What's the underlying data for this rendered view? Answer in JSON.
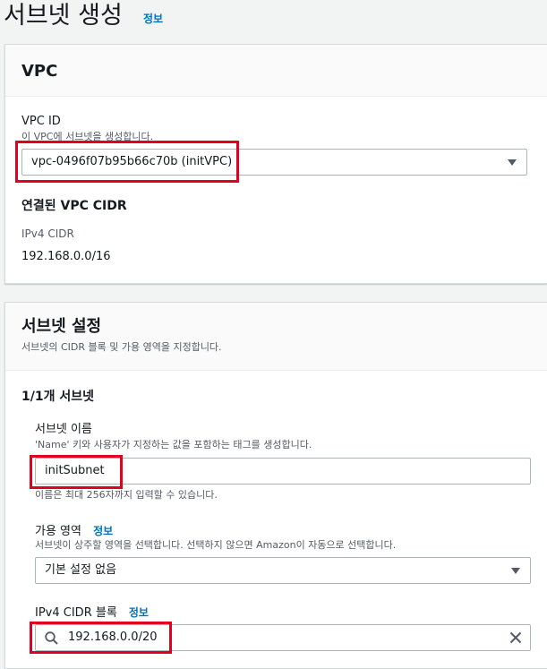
{
  "header": {
    "title": "서브넷 생성",
    "info": "정보"
  },
  "vpc_card": {
    "title": "VPC",
    "vpc_id_label": "VPC ID",
    "vpc_id_desc": "이 VPC에 서브넷을 생성합니다.",
    "vpc_id_value": "vpc-0496f07b95b66c70b (initVPC)",
    "cidr_heading": "연결된 VPC CIDR",
    "ipv4_cidr_label": "IPv4 CIDR",
    "ipv4_cidr_value": "192.168.0.0/16"
  },
  "subnet_card": {
    "title": "서브넷 설정",
    "desc": "서브넷의 CIDR 블록 및 가용 영역을 지정합니다.",
    "count_heading": "1/1개 서브넷",
    "name_label": "서브넷 이름",
    "name_desc": "'Name' 키와 사용자가 지정하는 값을 포함하는 태그를 생성합니다.",
    "name_value": "initSubnet",
    "name_hint": "이름은 최대 256자까지 입력할 수 있습니다.",
    "az_label": "가용 영역",
    "az_info": "정보",
    "az_desc": "서브넷이 상주할 영역을 선택합니다. 선택하지 않으면 Amazon이 자동으로 선택합니다.",
    "az_value": "기본 설정 없음",
    "cidr_label": "IPv4 CIDR 블록",
    "cidr_info": "정보",
    "cidr_value": "192.168.0.0/20"
  },
  "colors": {
    "highlight": "#e0001f",
    "link": "#0073bb"
  }
}
